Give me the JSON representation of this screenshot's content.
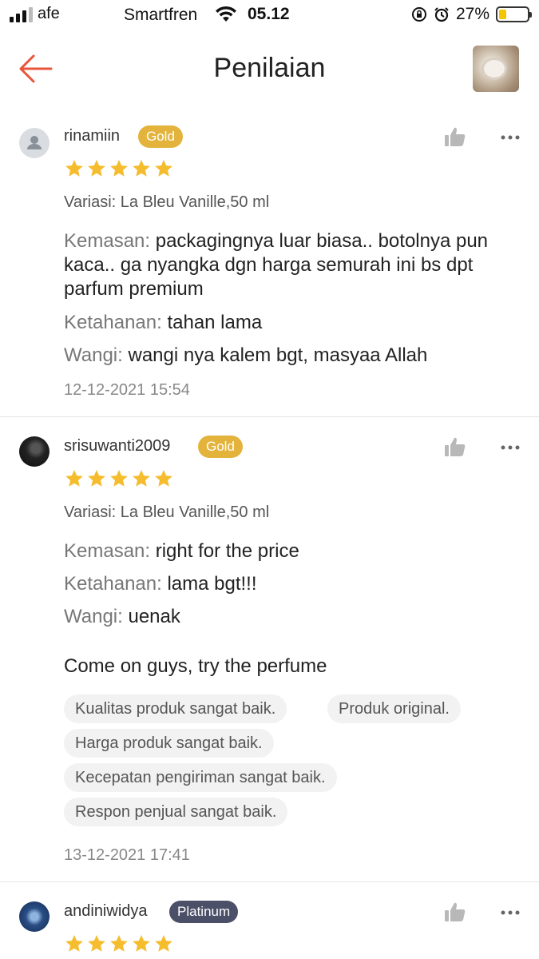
{
  "status_bar": {
    "carrier_left": "afe",
    "carrier": "Smartfren",
    "time": "05.12",
    "battery_pct": "27%",
    "battery_level": 0.27,
    "battery_color": "#f3c400"
  },
  "header": {
    "title": "Penilaian",
    "back_icon": "arrow-left-icon",
    "accent": "#e8553a"
  },
  "reviews": [
    {
      "username": "rinamiin",
      "badge": "Gold",
      "rating": 5,
      "variasi": "Variasi: La Bleu Vanille,50 ml",
      "kemasan_label": "Kemasan:",
      "kemasan_text": "packagingnya luar biasa.. botolnya pun kaca.. ga nyangka dgn harga semurah ini bs dpt parfum premium",
      "ketahanan_label": "Ketahanan:",
      "ketahanan_text": "tahan lama",
      "wangi_label": "Wangi:",
      "wangi_text": "wangi nya kalem bgt, masyaa Allah",
      "date": "12-12-2021 15:54"
    },
    {
      "username": "srisuwanti2009",
      "badge": "Gold",
      "rating": 5,
      "variasi": "Variasi: La Bleu Vanille,50 ml",
      "kemasan_label": "Kemasan:",
      "kemasan_text": "right for the price",
      "ketahanan_label": "Ketahanan:",
      "ketahanan_text": "lama bgt!!!",
      "wangi_label": "Wangi:",
      "wangi_text": "uenak",
      "comment": "Come on guys, try the perfume",
      "tags": [
        "Kualitas produk sangat baik.",
        "Produk original.",
        "Harga produk sangat baik.",
        "Kecepatan pengiriman sangat baik.",
        "Respon penjual sangat baik."
      ],
      "date": "13-12-2021 17:41"
    },
    {
      "username": "andiniwidya",
      "badge": "Platinum",
      "rating": 5
    }
  ],
  "colors": {
    "gold_badge": "#e3b33b",
    "platinum_badge": "#4b5068",
    "star": "#f5bd2e"
  }
}
